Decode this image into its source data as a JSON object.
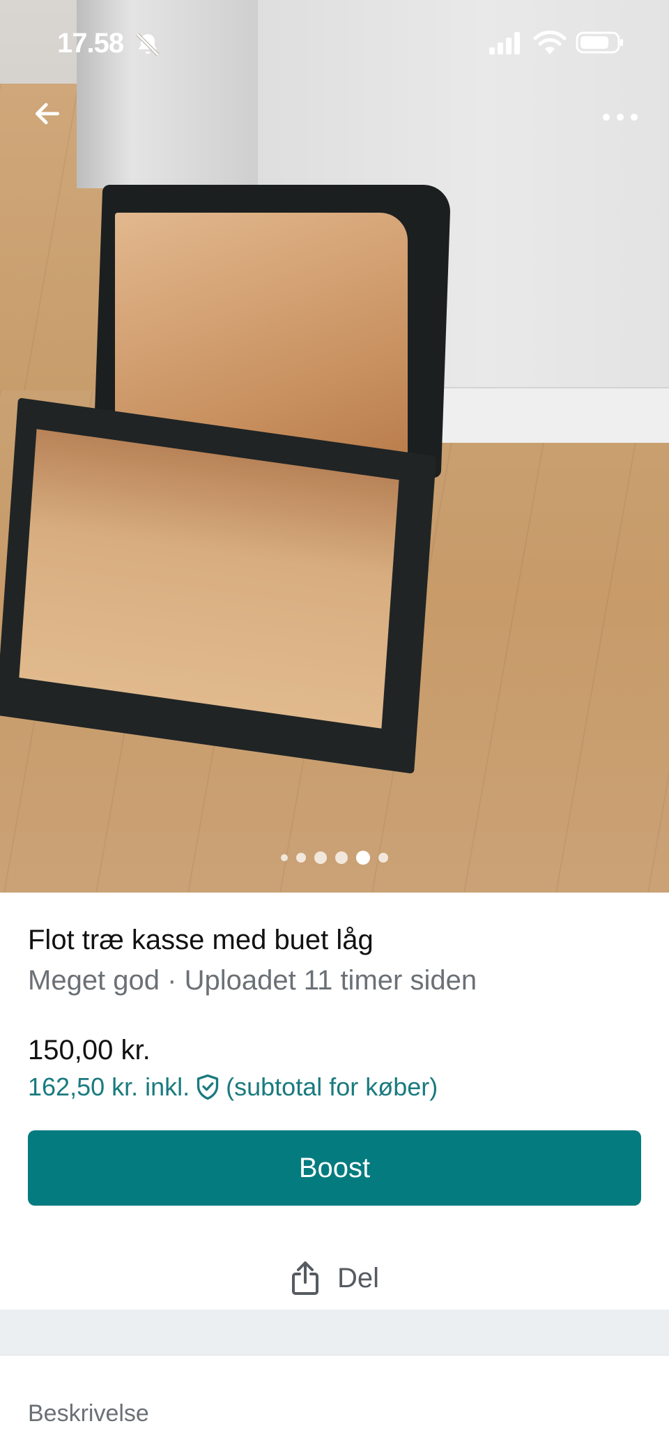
{
  "status_bar": {
    "time": "17.58",
    "icons": [
      "bell-slash-icon",
      "signal-icon",
      "wifi-icon",
      "battery-icon"
    ]
  },
  "nav": {
    "back_icon": "arrow-left-icon",
    "more_icon": "more-horizontal-icon"
  },
  "gallery": {
    "image_count": 6,
    "active_index": 4
  },
  "listing": {
    "title": "Flot træ kasse med buet låg",
    "subtitle": "Meget god · Uploadet 11 timer siden",
    "price": "150,00 kr.",
    "price_incl": "162,50 kr. inkl.",
    "price_incl_note": "(subtotal for køber)"
  },
  "actions": {
    "boost_label": "Boost",
    "share_label": "Del",
    "share_icon": "share-icon"
  },
  "description": {
    "heading": "Beskrivelse"
  },
  "colors": {
    "accent": "#047b7f",
    "accent_text": "#1a7a7e",
    "muted_text": "#6b7075"
  }
}
